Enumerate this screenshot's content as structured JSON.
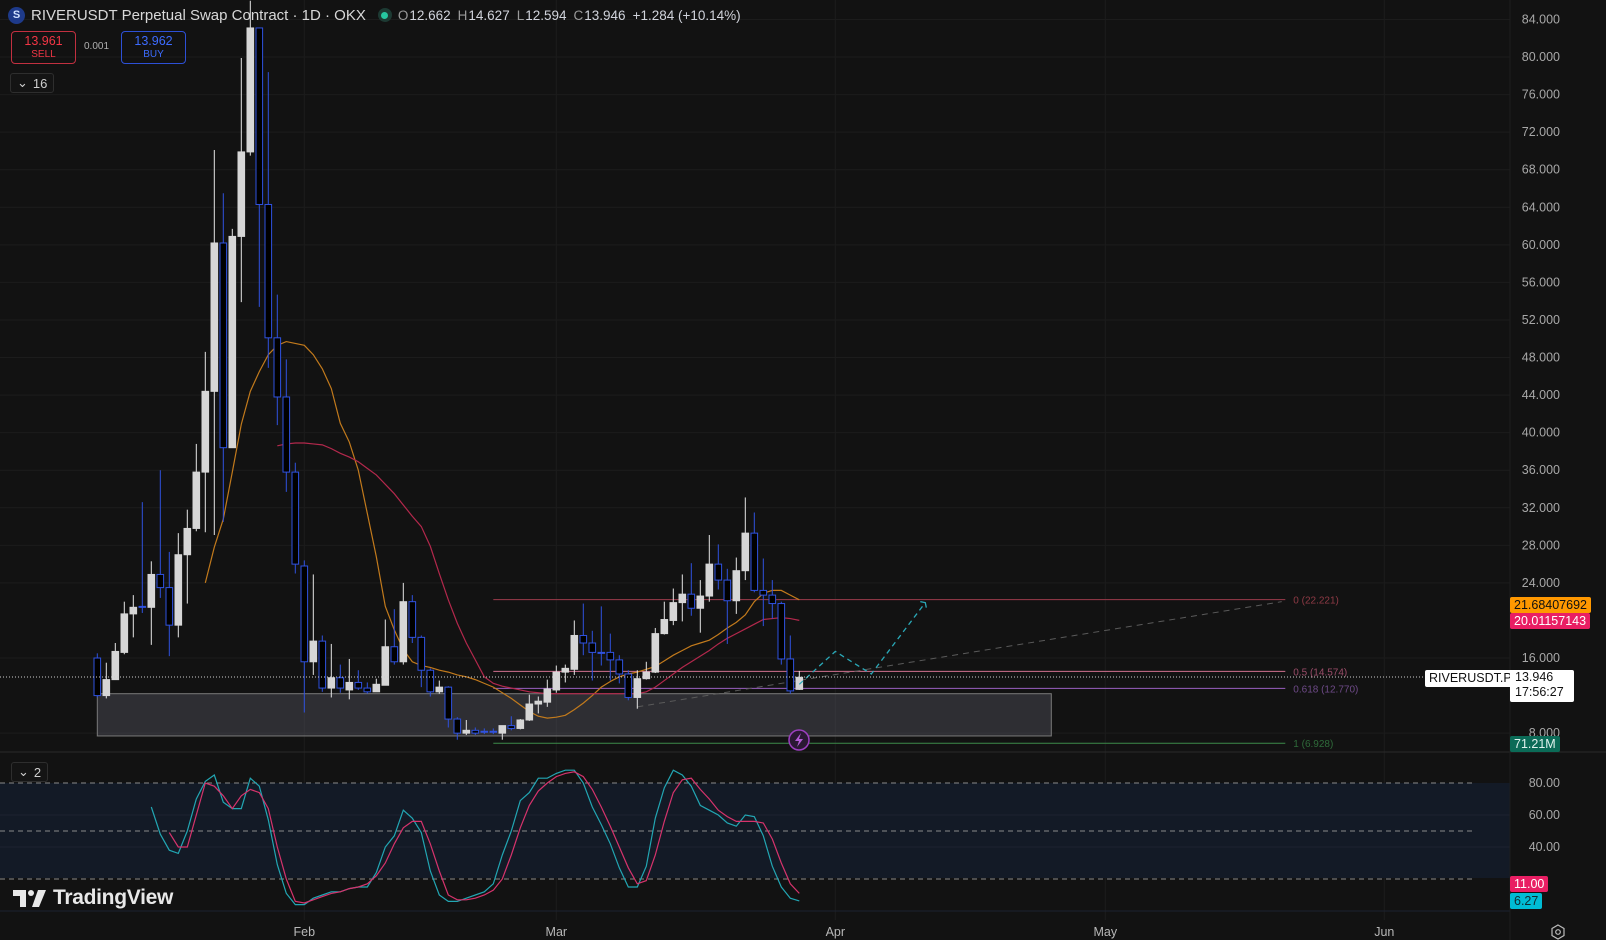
{
  "header": {
    "logo_letter": "S",
    "title": "RIVERUSDT Perpetual Swap Contract · 1D · OKX",
    "open_label": "O",
    "open": "12.662",
    "high_label": "H",
    "high": "14.627",
    "low_label": "L",
    "low": "12.594",
    "close_label": "C",
    "close": "13.946",
    "change": "+1.284 (+10.14%)"
  },
  "trade": {
    "sell_price": "13.961",
    "sell_label": "SELL",
    "spread": "0.001",
    "buy_price": "13.962",
    "buy_label": "BUY"
  },
  "main_pane": {
    "collapse_count": "16"
  },
  "osc_pane": {
    "collapse_count": "2"
  },
  "branding": "TradingView",
  "last_price": {
    "symbol": "RIVERUSDT.P",
    "price": "13.946",
    "countdown": "17:56:27"
  },
  "axis_tags": {
    "ma_fast": "21.68407692",
    "ma_slow": "20.01157143",
    "indicator_value": "71.21M",
    "stoch_d": "11.00",
    "stoch_k": "6.27"
  },
  "colors": {
    "up": "#d6d6d6",
    "down_border": "#2f52e0",
    "ma_fast": "#c27a1c",
    "ma_slow": "#b3284c",
    "stoch_k": "#22a6b3",
    "stoch_d": "#d6336c",
    "ma_fast_tag": "#ff9800",
    "ma_slow_tag": "#e91e63",
    "indicator_tag": "#0b6b57",
    "stoch_d_tag": "#e91e63",
    "stoch_k_tag": "#00bcd4"
  },
  "chart_data": {
    "type": "candlestick",
    "title": "RIVERUSDT Perpetual Swap Contract · 1D · OKX",
    "price_ticks": [
      "84.000",
      "80.000",
      "76.000",
      "72.000",
      "68.000",
      "64.000",
      "60.000",
      "56.000",
      "52.000",
      "48.000",
      "44.000",
      "40.000",
      "36.000",
      "32.000",
      "28.000",
      "24.000",
      "16.000",
      "8.000"
    ],
    "x_ticks": [
      {
        "label": "Feb",
        "index": 23
      },
      {
        "label": "Mar",
        "index": 51
      },
      {
        "label": "Apr",
        "index": 82
      },
      {
        "label": "May",
        "index": 112
      },
      {
        "label": "Jun",
        "index": 143
      }
    ],
    "ohlc": [
      [
        16.0,
        16.5,
        11.8,
        12.0
      ],
      [
        12.0,
        15.5,
        11.7,
        13.7
      ],
      [
        13.7,
        17.6,
        13.7,
        16.7
      ],
      [
        16.6,
        22.0,
        16.4,
        20.7
      ],
      [
        20.7,
        22.7,
        18.2,
        21.4
      ],
      [
        21.5,
        32.6,
        20.8,
        21.4
      ],
      [
        21.4,
        26.3,
        17.4,
        24.9
      ],
      [
        24.9,
        36.0,
        22.4,
        23.5
      ],
      [
        23.5,
        27.3,
        16.2,
        19.5
      ],
      [
        19.5,
        29.3,
        18.2,
        27.0
      ],
      [
        27.0,
        31.8,
        21.8,
        29.8
      ],
      [
        29.8,
        38.8,
        29.5,
        35.8
      ],
      [
        35.8,
        48.6,
        29.4,
        44.4
      ],
      [
        44.4,
        70.1,
        29.1,
        60.2
      ],
      [
        60.2,
        65.5,
        30.5,
        38.4
      ],
      [
        38.4,
        61.7,
        38.4,
        60.9
      ],
      [
        60.9,
        79.9,
        53.9,
        69.9
      ],
      [
        69.9,
        86.0,
        69.5,
        83.1
      ],
      [
        83.1,
        83.1,
        53.4,
        64.3
      ],
      [
        64.3,
        78.4,
        46.9,
        50.1
      ],
      [
        50.1,
        54.7,
        40.8,
        43.8
      ],
      [
        43.8,
        47.8,
        33.7,
        35.8
      ],
      [
        35.8,
        36.8,
        25.0,
        26.0
      ],
      [
        25.8,
        26.4,
        10.2,
        15.6
      ],
      [
        15.6,
        24.9,
        14.2,
        17.8
      ],
      [
        17.8,
        18.4,
        12.4,
        12.8
      ],
      [
        12.8,
        17.5,
        11.8,
        13.9
      ],
      [
        13.9,
        15.3,
        12.3,
        12.8
      ],
      [
        12.6,
        15.9,
        11.6,
        13.4
      ],
      [
        13.4,
        14.7,
        12.6,
        12.8
      ],
      [
        12.8,
        13.4,
        12.2,
        12.4
      ],
      [
        12.4,
        13.8,
        12.4,
        13.2
      ],
      [
        13.1,
        20.1,
        13.1,
        17.2
      ],
      [
        17.2,
        21.2,
        15.3,
        15.6
      ],
      [
        15.6,
        24.0,
        15.3,
        22.0
      ],
      [
        22.0,
        22.7,
        17.6,
        18.2
      ],
      [
        18.2,
        18.4,
        12.9,
        14.7
      ],
      [
        14.7,
        14.9,
        11.9,
        12.4
      ],
      [
        12.4,
        13.6,
        12.2,
        12.9
      ],
      [
        12.9,
        13.0,
        8.6,
        9.5
      ],
      [
        9.5,
        9.7,
        7.3,
        8.0
      ],
      [
        8.0,
        9.4,
        7.8,
        8.3
      ],
      [
        8.3,
        8.6,
        7.8,
        8.0
      ],
      [
        8.2,
        8.5,
        7.9,
        8.1
      ],
      [
        8.2,
        8.5,
        7.9,
        8.1
      ],
      [
        8.0,
        8.8,
        7.3,
        8.8
      ],
      [
        8.8,
        9.8,
        8.3,
        8.5
      ],
      [
        8.5,
        9.5,
        8.4,
        9.4
      ],
      [
        9.4,
        12.1,
        9.3,
        11.1
      ],
      [
        11.1,
        11.9,
        10.1,
        11.4
      ],
      [
        11.3,
        13.7,
        10.8,
        12.7
      ],
      [
        12.6,
        15.2,
        12.3,
        14.5
      ],
      [
        14.5,
        15.3,
        13.4,
        14.9
      ],
      [
        14.8,
        20.0,
        14.2,
        18.4
      ],
      [
        18.4,
        21.8,
        16.3,
        17.6
      ],
      [
        17.6,
        18.9,
        13.6,
        16.6
      ],
      [
        16.6,
        21.5,
        15.2,
        16.5
      ],
      [
        16.6,
        18.6,
        13.6,
        15.8
      ],
      [
        15.8,
        16.3,
        13.3,
        14.3
      ],
      [
        14.3,
        14.7,
        11.5,
        11.8
      ],
      [
        11.8,
        14.7,
        10.6,
        13.8
      ],
      [
        13.8,
        15.6,
        13.7,
        14.5
      ],
      [
        14.5,
        19.2,
        14.4,
        18.6
      ],
      [
        18.6,
        22.0,
        18.5,
        20.1
      ],
      [
        20.0,
        23.4,
        19.5,
        21.9
      ],
      [
        21.9,
        24.9,
        19.9,
        22.8
      ],
      [
        22.8,
        26.1,
        20.5,
        21.3
      ],
      [
        21.3,
        24.3,
        18.7,
        22.6
      ],
      [
        22.6,
        29.1,
        22.0,
        26.0
      ],
      [
        26.0,
        28.1,
        23.3,
        24.3
      ],
      [
        24.3,
        25.5,
        17.5,
        22.1
      ],
      [
        22.1,
        26.7,
        20.7,
        25.3
      ],
      [
        25.3,
        33.1,
        24.3,
        29.3
      ],
      [
        29.3,
        31.5,
        23.0,
        23.2
      ],
      [
        23.2,
        26.6,
        19.4,
        22.7
      ],
      [
        22.7,
        24.3,
        20.2,
        21.8
      ],
      [
        21.8,
        22.0,
        15.3,
        15.9
      ],
      [
        15.9,
        18.4,
        12.2,
        12.5
      ],
      [
        12.662,
        14.627,
        12.594,
        13.946
      ]
    ],
    "ma_fast": {
      "start_index": 12,
      "values": [
        24,
        27.8,
        30.8,
        35.8,
        40.9,
        44.4,
        46.5,
        48.3,
        49.3,
        49.7,
        49.5,
        49.3,
        48.3,
        46.8,
        44.7,
        41,
        39,
        36,
        31.4,
        26.8,
        21.5,
        19,
        16.9,
        15.6,
        15.2,
        15,
        14.7,
        14.5,
        14.2,
        14,
        13.7,
        13.3,
        12.9,
        12.3,
        11.7,
        11,
        10.3,
        9.8,
        9.6,
        9.7,
        9.9,
        10.5,
        11.2,
        12,
        12.9,
        13.5,
        14,
        14.3,
        14.5,
        14.8,
        15.1,
        15.7,
        16.3,
        16.8,
        17.3,
        17.6,
        17.9,
        18.5,
        19.2,
        19.8,
        20.6,
        22,
        22.9,
        23.2,
        23.2,
        22.7,
        22.2
      ]
    },
    "ma_slow": {
      "start_index": 20,
      "values": [
        38.6,
        38.8,
        38.9,
        38.9,
        38.8,
        38.7,
        38.3,
        37.8,
        37.4,
        36.9,
        36.2,
        35.5,
        34.5,
        33.5,
        32.3,
        31.1,
        30,
        27.9,
        25,
        22.2,
        19.7,
        17.6,
        15.8,
        14,
        13.3,
        13,
        12.8,
        12.6,
        12.4,
        12.3,
        12.2,
        12.2,
        12.2,
        12.2,
        12.2,
        12.2,
        12.2,
        12.2,
        12.2,
        12.2,
        12.2,
        12.4,
        12.9,
        13.6,
        14.3,
        15,
        15.6,
        16.2,
        16.8,
        17.5,
        18.1,
        18.6,
        19.1,
        19.6,
        20.1,
        20.2,
        20.3,
        20.2,
        20.01
      ]
    },
    "fib_levels": [
      {
        "label": "0 (22.221)",
        "price": 22.221,
        "color": "#9c3b4b",
        "text_color": "#8e3a45"
      },
      {
        "label": "0.5 (14.574)",
        "price": 14.574,
        "color": "#d0708f",
        "text_color": "#9a4c68"
      },
      {
        "label": "0.618 (12.770)",
        "price": 12.77,
        "color": "#9a5fc0",
        "text_color": "#6e4a88"
      },
      {
        "label": "1 (6.928)",
        "price": 6.928,
        "color": "#3d8b4a",
        "text_color": "#2f6b3a"
      }
    ],
    "fib_index_range": [
      44,
      132
    ],
    "zone": {
      "price_top": 12.2,
      "price_bottom": 7.7,
      "index_range": [
        0,
        106
      ]
    },
    "trendline": [
      [
        60,
        10.8
      ],
      [
        131.6,
        22.0
      ]
    ],
    "projection": [
      [
        78,
        13.2
      ],
      [
        82,
        16.7
      ],
      [
        86,
        14.3
      ],
      [
        92,
        21.9
      ]
    ],
    "oscillator": {
      "type": "stochastic",
      "ticks": [
        "80.00",
        "60.00",
        "40.00"
      ],
      "levels": [
        80,
        50,
        20
      ],
      "k": {
        "start_index": 6,
        "values": [
          65,
          48,
          38,
          36,
          50,
          70,
          81,
          85,
          68,
          64,
          64,
          83,
          78,
          57,
          29,
          11,
          4,
          4,
          8,
          10,
          12,
          12,
          14,
          15,
          15,
          24,
          40,
          47,
          63,
          58,
          49,
          25,
          10,
          6,
          6,
          8,
          10,
          12,
          17,
          35,
          50,
          69,
          74,
          83,
          83,
          86,
          88,
          88,
          80,
          65,
          54,
          42,
          27,
          15,
          15,
          28,
          58,
          77,
          88,
          85,
          78,
          66,
          63,
          60,
          55,
          53,
          60,
          59,
          47,
          28,
          15,
          8,
          6.27
        ]
      },
      "d": {
        "start_index": 8,
        "values": [
          49,
          40,
          40,
          60,
          80,
          78,
          72,
          64,
          72,
          76,
          74,
          64,
          40,
          20,
          6,
          5,
          7,
          9,
          11,
          12,
          14,
          15,
          17,
          22,
          30,
          42,
          52,
          56,
          56,
          42,
          25,
          10,
          7,
          7,
          8,
          10,
          13,
          20,
          35,
          52,
          66,
          75,
          80,
          84,
          86,
          87,
          84,
          76,
          65,
          53,
          40,
          27,
          17,
          19,
          35,
          56,
          74,
          82,
          83,
          76,
          70,
          63,
          59,
          56,
          56,
          56,
          55,
          45,
          30,
          17,
          11
        ]
      }
    }
  }
}
